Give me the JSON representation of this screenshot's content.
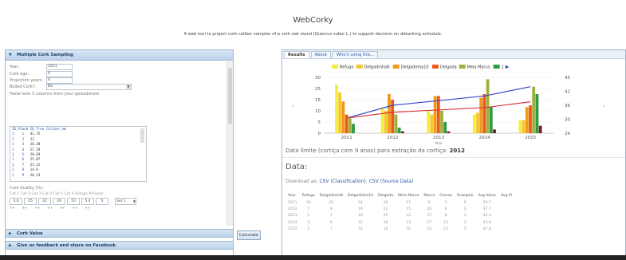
{
  "header": {
    "title": "WebCorky",
    "subtitle": "A web tool to project cork caliber samples of a cork oak stand (Quercus suber L.) to support decision on debarking schedule."
  },
  "left_panel": {
    "section_title": "Multiple Cork Sampling",
    "fields": [
      {
        "label": "Year:",
        "value": "2011"
      },
      {
        "label": "Cork age:",
        "value": "9"
      },
      {
        "label": "Projection years:",
        "value": "4"
      }
    ],
    "boiled": {
      "label": "Boiled Cork?:",
      "value": "No"
    },
    "paste_label": "Paste here 3 columns from your spreadsheet",
    "textarea_header": "ID_Stand ID_Tree Caliber_mm",
    "textarea_rows": [
      [
        "1",
        "1",
        "41.75"
      ],
      [
        "1",
        "2",
        "22"
      ],
      [
        "1",
        "3",
        "26.38"
      ],
      [
        "1",
        "4",
        "27.29"
      ],
      [
        "1",
        "5",
        "28.69"
      ],
      [
        "1",
        "6",
        "25.07"
      ],
      [
        "1",
        "7",
        "23.22"
      ],
      [
        "1",
        "8",
        "14.9"
      ],
      [
        "1",
        "9",
        "28.24"
      ]
    ],
    "quality_label": "Cork Quality (%):",
    "quality_cats": "Cat 1 Cat 2 Cat 3 Cat 4 Cat 5 Cat 6 Refugo PreSets:",
    "quality_values": [
      "3.6",
      "25",
      "22",
      "20",
      "10",
      "5.4",
      "5"
    ],
    "preset": "Set 1",
    "spinners": [
      "++",
      "++",
      "++",
      "++",
      "++",
      "++",
      "++"
    ],
    "section2": "Cork Value",
    "section3": "Give us feedback and share on Facebook"
  },
  "calculate_label": "Calculate",
  "tabs": [
    {
      "label": "Results",
      "active": true
    },
    {
      "label": "About",
      "active": false
    },
    {
      "label": "Who's using this...",
      "active": false
    }
  ],
  "chart_data": {
    "type": "bar",
    "legend": [
      "Refugo",
      "Delgadinha8",
      "Delgadinha10",
      "Delgada",
      "Meia Marca",
      "1"
    ],
    "colors": [
      "#f2ef3a",
      "#f7c531",
      "#f09a1c",
      "#ec5a1b",
      "#9eb13c",
      "#2f9a45",
      "#7b1b2e"
    ],
    "categories": [
      "2011",
      "2012",
      "2013",
      "2014",
      "2015"
    ],
    "xlabel": "Year",
    "ylim_left": [
      0,
      30
    ],
    "yticks_left": [
      "30",
      "25",
      "15",
      "10",
      "5",
      "0"
    ],
    "yticks_right": [
      "45",
      "42",
      "36",
      "30",
      "24"
    ],
    "series_values": [
      [
        26,
        22,
        17,
        10,
        8,
        5,
        0
      ],
      [
        14,
        12,
        21,
        18,
        10,
        3,
        1
      ],
      [
        12,
        10,
        20,
        20,
        12,
        6,
        1
      ],
      [
        10,
        11,
        19,
        21,
        29,
        14,
        2
      ],
      [
        7,
        7,
        14,
        15,
        25,
        21,
        4
      ]
    ],
    "line_blue": [
      30.5,
      36,
      38,
      40,
      44
    ],
    "line_red": [
      30.5,
      33,
      34,
      35,
      37.5
    ],
    "right_range": [
      24,
      48
    ]
  },
  "limit_text": "Data limite (cortiça com 9 anos) para extração da cortiça:",
  "limit_year": "2012",
  "data_title": "Data:",
  "download": {
    "prefix": "Download as:",
    "csv1": "CSV (Classification)",
    "csv2": "CSV (Source Data)"
  },
  "table": {
    "headers": [
      "Year",
      "Refugo",
      "Delgadinha8",
      "Delgadinha10",
      "Delgada",
      "Meia Marca",
      "Marca",
      "Grossa",
      "Sranqule",
      "Avg Value",
      "Avg Pr"
    ],
    "rows": [
      [
        "2011",
        "10",
        "20",
        "24",
        "18",
        "17",
        "8",
        "3",
        "0",
        "29.7",
        ""
      ],
      [
        "2012",
        "7",
        "9",
        "19",
        "22",
        "15",
        "20",
        "6",
        "2",
        "37.7",
        ""
      ],
      [
        "2013",
        "5",
        "7",
        "18",
        "20",
        "12",
        "27",
        "8",
        "3",
        "41.3",
        ""
      ],
      [
        "2014",
        "3",
        "6",
        "15",
        "18",
        "13",
        "27",
        "12",
        "3",
        "43.6",
        ""
      ],
      [
        "2015",
        "2",
        "7",
        "14",
        "14",
        "16",
        "24",
        "15",
        "5",
        "47.8",
        ""
      ]
    ]
  }
}
